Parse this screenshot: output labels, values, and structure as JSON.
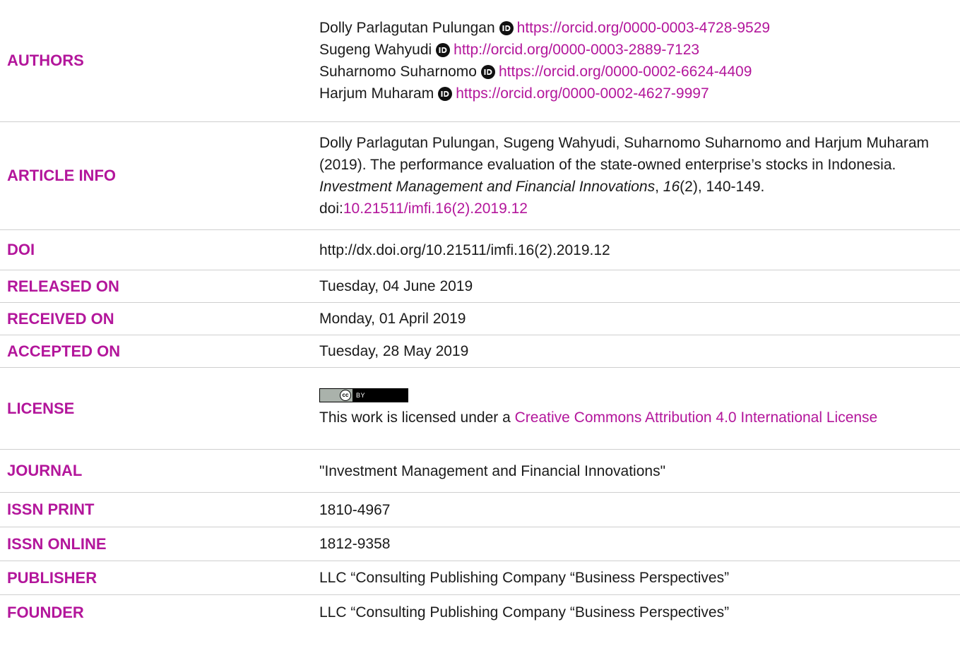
{
  "rows": {
    "authors": {
      "label": "AUTHORS",
      "list": [
        {
          "name": "Dolly Parlagutan Pulungan",
          "orcid": "https://orcid.org/0000-0003-4728-9529"
        },
        {
          "name": "Sugeng Wahyudi",
          "orcid": "http://orcid.org/0000-0003-2889-7123"
        },
        {
          "name": "Suharnomo Suharnomo",
          "orcid": "https://orcid.org/0000-0002-6624-4409"
        },
        {
          "name": "Harjum Muharam",
          "orcid": "https://orcid.org/0000-0002-4627-9997"
        }
      ]
    },
    "article_info": {
      "label": "ARTICLE INFO",
      "citation_authors": "Dolly Parlagutan Pulungan, Sugeng Wahyudi, Suharnomo Suharnomo and Harjum Muharam (2019). The performance evaluation of the state-owned enterprise’s stocks in Indonesia. ",
      "journal_italic": "Investment Management and Financial Innovations",
      "sep1": ", ",
      "volume_italic": "16",
      "issue_pages": "(2), 140-149. doi:",
      "doi_link": "10.21511/imfi.16(2).2019.12"
    },
    "doi": {
      "label": "DOI",
      "value": "http://dx.doi.org/10.21511/imfi.16(2).2019.12"
    },
    "released_on": {
      "label": "RELEASED ON",
      "value": "Tuesday, 04 June 2019"
    },
    "received_on": {
      "label": "RECEIVED ON",
      "value": "Monday, 01 April 2019"
    },
    "accepted_on": {
      "label": "ACCEPTED ON",
      "value": "Tuesday, 28 May 2019"
    },
    "license": {
      "label": "LICENSE",
      "badge_cc": "cc",
      "badge_by": "BY",
      "text": "This work is licensed under a ",
      "link": "Creative Commons Attribution 4.0 International License"
    },
    "journal": {
      "label": "JOURNAL",
      "value": "\"Investment Management and Financial Innovations\""
    },
    "issn_print": {
      "label": "ISSN PRINT",
      "value": "1810-4967"
    },
    "issn_online": {
      "label": "ISSN ONLINE",
      "value": "1812-9358"
    },
    "publisher": {
      "label": "PUBLISHER",
      "value": "LLC “Consulting Publishing Company “Business Perspectives”"
    },
    "founder": {
      "label": "FOUNDER",
      "value": "LLC “Consulting Publishing Company “Business Perspectives”"
    }
  },
  "colors": {
    "label": "#b3169b",
    "link": "#b3169b",
    "text": "#1a1a1a",
    "divider": "#cfcfcf"
  },
  "icons": {
    "orcid": "orcid-id-icon",
    "license": "cc-by-badge-icon"
  }
}
